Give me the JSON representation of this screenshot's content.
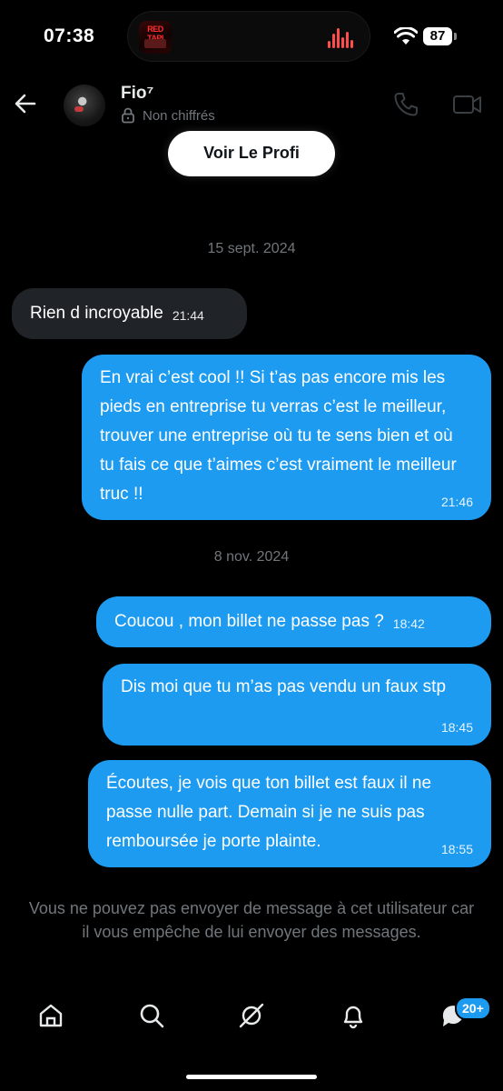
{
  "status_bar": {
    "time": "07:38",
    "battery": "87",
    "now_playing_art_text": "RED TAPI",
    "accent_color": "#ff4c4c"
  },
  "header": {
    "contact_name": "Fio⁷",
    "encryption_status": "Non chiffrés",
    "icons": [
      "back-arrow-icon",
      "lock-icon",
      "phone-icon",
      "video-icon"
    ]
  },
  "profile_button_label": "Voir Le Profi",
  "conversation": {
    "date_1": "15 sept. 2024",
    "msg_1": {
      "text": "Rien d incroyable",
      "time": "21:44",
      "direction": "received"
    },
    "msg_2": {
      "text": "En vrai c’est cool !! Si t’as pas encore mis les pieds en entreprise tu verras c’est le meilleur, trouver une entreprise où tu te sens bien et où tu fais ce que t’aimes c’est vraiment le meilleur truc !!",
      "time": "21:46",
      "direction": "sent"
    },
    "date_2": "8 nov. 2024",
    "msg_3": {
      "text": "Coucou , mon billet ne passe pas ?",
      "time": "18:42",
      "direction": "sent"
    },
    "msg_4": {
      "text": "Dis moi que tu m’as pas vendu un faux stp",
      "time": "18:45",
      "direction": "sent"
    },
    "msg_5": {
      "text": "Écoutes, je vois que ton billet est faux il ne passe nulle part. Demain si je ne suis pas remboursée je porte plainte.",
      "time": "18:55",
      "direction": "sent"
    }
  },
  "blocked_notice": "Vous ne pouvez pas envoyer de message à cet utilisateur car il vous empêche de lui envoyer des messages.",
  "bottom_nav": {
    "items": [
      "home-icon",
      "search-icon",
      "grok-icon",
      "notifications-icon",
      "messages-icon"
    ],
    "messages_badge": "20+"
  },
  "colors": {
    "background": "#000000",
    "sent_bubble": "#1d9bf0",
    "received_bubble": "#202327",
    "muted_text": "#71767b"
  }
}
